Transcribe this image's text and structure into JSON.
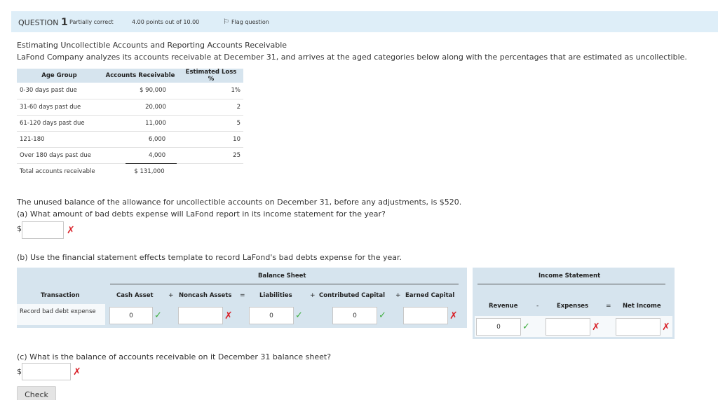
{
  "header": {
    "question_label": "QUESTION",
    "question_number": "1",
    "state": "Partially correct",
    "grade": "4.00 points out of 10.00",
    "flag": "Flag question"
  },
  "title": "Estimating Uncollectible Accounts and Reporting Accounts Receivable",
  "intro": "LaFond Company analyzes its accounts receivable at December 31, and arrives at the aged categories below along with the percentages that are estimated as uncollectible.",
  "aging_table": {
    "headers": [
      "Age Group",
      "Accounts Receivable",
      "Estimated Loss %"
    ],
    "rows": [
      [
        "0-30 days past due",
        "$ 90,000",
        "1%"
      ],
      [
        "31-60 days past due",
        "20,000",
        "2"
      ],
      [
        "61-120 days past due",
        "11,000",
        "5"
      ],
      [
        "121-180",
        "6,000",
        "10"
      ],
      [
        "Over 180 days past due",
        "4,000",
        "25"
      ],
      [
        "Total accounts receivable",
        "$ 131,000",
        ""
      ]
    ]
  },
  "unused_balance": "The unused balance of the allowance for uncollectible accounts on December 31, before any adjustments, is $520.",
  "part_a": {
    "question": "(a) What amount of bad debts expense will LaFond report in its income statement for the year?",
    "currency": "$",
    "value": ""
  },
  "part_b": {
    "question": "(b) Use the financial statement effects template to record LaFond's bad debts expense for the year.",
    "balance_sheet_label": "Balance Sheet",
    "income_statement_label": "Income Statement",
    "columns": {
      "transaction": "Transaction",
      "cash_asset": "Cash Asset",
      "noncash_assets": "Noncash Assets",
      "liabilities": "Liabilities",
      "contributed_capital": "Contributed Capital",
      "earned_capital": "Earned Capital",
      "revenue": "Revenue",
      "expenses": "Expenses",
      "net_income": "Net Income"
    },
    "operators": {
      "plus": "+",
      "equals": "=",
      "minus": "-"
    },
    "row_label": "Record bad debt expense",
    "values": {
      "cash_asset": "0",
      "noncash_assets": "",
      "liabilities": "0",
      "contributed_capital": "0",
      "earned_capital": "",
      "revenue": "0",
      "expenses": "",
      "net_income": ""
    }
  },
  "part_c": {
    "question": "(c) What is the balance of accounts receivable on it December 31 balance sheet?",
    "currency": "$",
    "value": ""
  },
  "marks": {
    "correct": "✓",
    "incorrect": "✗"
  },
  "check_label": "Check",
  "colors": {
    "header_bg": "#deeef8",
    "panel_bg": "#d6e4ee",
    "correct": "#3fae3f",
    "incorrect": "#d9232a"
  }
}
